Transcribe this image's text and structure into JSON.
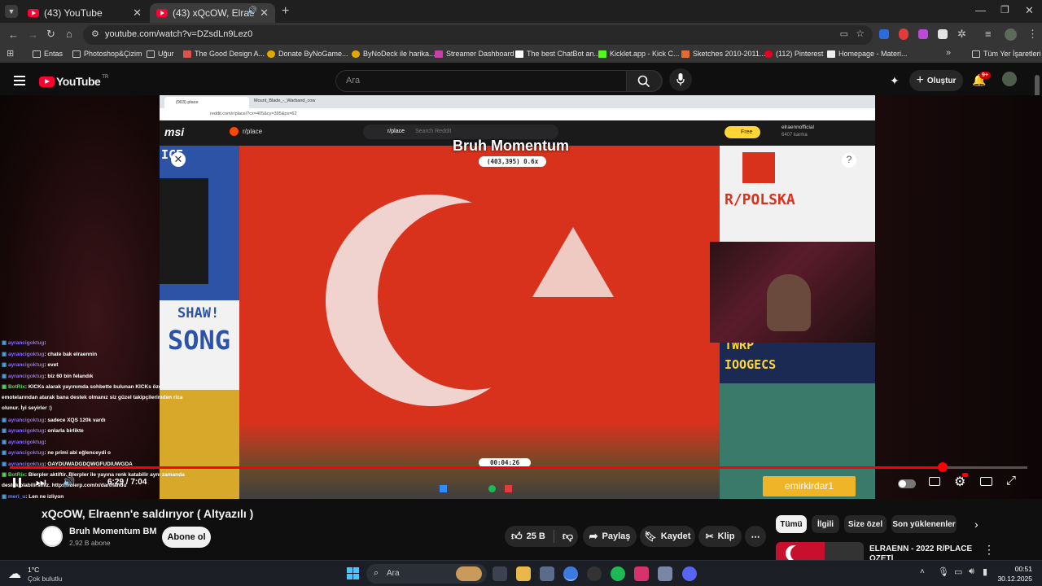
{
  "browser": {
    "tabs": [
      {
        "title": "(43) YouTube",
        "active": false
      },
      {
        "title": "(43) xQcOW, Elraenn'e saldır",
        "active": true
      }
    ],
    "url": "youtube.com/watch?v=DZsdLn9Lez0",
    "bookmarks": [
      "Entas",
      "Photoshop&Çizim",
      "Uğur",
      "The Good Design A...",
      "Donate ByNoGame...",
      "ByNoDeck ile harika...",
      "Streamer Dashboard",
      "The best ChatBot an...",
      "Kicklet.app - Kick C...",
      "Sketches 2010-2011...",
      "(112) Pinterest",
      "Homepage - Materi..."
    ],
    "all_bookmarks": "Tüm Yer İşaretleri"
  },
  "youtube": {
    "logo_text": "YouTube",
    "logo_region": "TR",
    "search_placeholder": "Ara",
    "create_label": "Oluştur",
    "notif_badge": "9+"
  },
  "video": {
    "inner_browser": {
      "tab1": "(903) place",
      "tab2": "Mount_Blade_-_Warband_cow",
      "url": "reddit.com/r/place/?cx=405&cy=395&px=62",
      "subreddit": "r/place",
      "search": "Search Reddit",
      "free_label": "Free",
      "user": "elraennofficial",
      "karma": "6407 karma",
      "overlay_title": "Bruh Momentum",
      "coords": "(403,395) 0.6x",
      "timer": "00:04:26",
      "brand": "msi"
    },
    "left_art": {
      "ice": "ICE",
      "shaw": "SHAW!",
      "song": "SONG"
    },
    "right_art": {
      "polska": "R/POLSKA",
      "twrp": "TWRP",
      "loogecs": "IOOGECS"
    },
    "watermark": "emirkirdar1",
    "chat": [
      {
        "nick": "ayrancigoktug",
        "msg": ": ",
        "color": "p"
      },
      {
        "nick": "ayrancigoktug",
        "msg": ": chate bak elraennin",
        "color": "p"
      },
      {
        "nick": "ayrancigoktug",
        "msg": ": evet",
        "color": "p"
      },
      {
        "nick": "ayrancigoktug",
        "msg": ": biz 60 bin felandık",
        "color": "p"
      },
      {
        "nick": "BotRix",
        "msg": ": KICKs alarak yayınımda sohbette bulunan KICKs özel",
        "color": "g"
      },
      {
        "nick": "",
        "msg": "emotelarından atarak bana destek olmanız siz güzel takipçilerimden rica",
        "color": "g"
      },
      {
        "nick": "",
        "msg": "olunur. İyi seyirler :)",
        "color": "g"
      },
      {
        "nick": "ayrancigoktug",
        "msg": ": sadece XQS 120k vardı",
        "color": "p"
      },
      {
        "nick": "ayrancigoktug",
        "msg": ": onlarla birlikte",
        "color": "p"
      },
      {
        "nick": "ayrancigoktug",
        "msg": ": ",
        "color": "p"
      },
      {
        "nick": "ayrancigoktug",
        "msg": ": ne primi abi eğlenceydi o",
        "color": "p"
      },
      {
        "nick": "ayrancigoktug",
        "msg": ": OAYDUWADGDQWGFUDIUWGDA",
        "color": "p"
      },
      {
        "nick": "BotRix",
        "msg": ": Blerpler aktiftir. Blerpler ile yayına renk katabilir aynı zamanda",
        "color": "g"
      },
      {
        "nick": "",
        "msg": "destek olabilirsiniz. https://blerp.com/x/darthandu",
        "color": "g"
      },
      {
        "nick": "meri_u",
        "msg": ": Len ne izliyon",
        "color": "b"
      }
    ],
    "time_current": "6:29",
    "time_total": "7:04",
    "progress": 0.917
  },
  "meta": {
    "title": "xQcOW, Elraenn'e saldırıyor ( Altyazılı )",
    "channel": "Bruh Momentum BM",
    "subscribers": "2,92 B abone",
    "subscribe_label": "Abone ol",
    "likes": "25 B",
    "share_label": "Paylaş",
    "save_label": "Kaydet",
    "clip_label": "Klip"
  },
  "sidebar": {
    "chips": [
      "Tümü",
      "İlgili",
      "Size özel",
      "Son yüklenenler"
    ],
    "next_title": "ELRAENN - 2022 R/PLACE",
    "next_title2": "ÖZETİ"
  },
  "taskbar": {
    "weather_temp": "1°C",
    "weather_desc": "Çok bulutlu",
    "search": "Ara",
    "time": "00:51",
    "date": "30.12.2025"
  }
}
